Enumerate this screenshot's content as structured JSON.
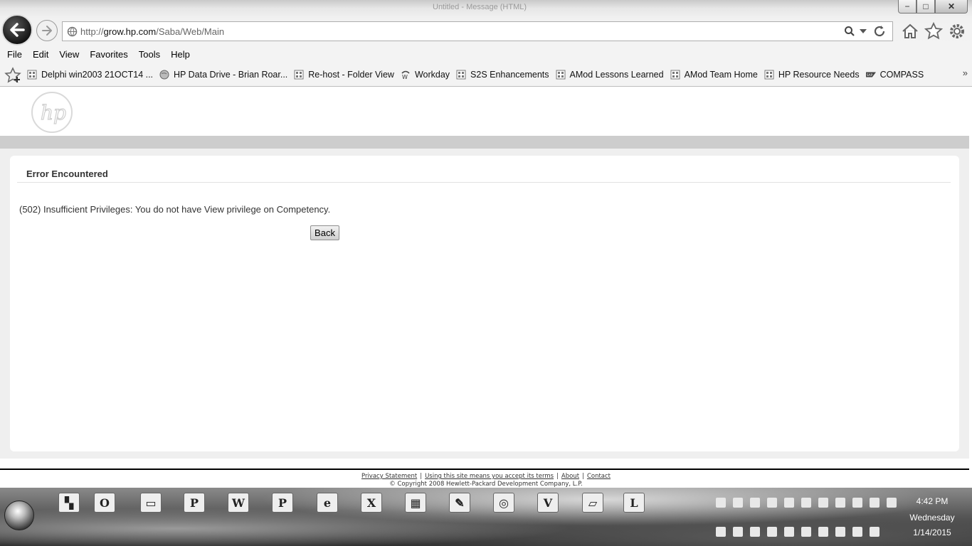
{
  "browser": {
    "window_title": "Untitled - Message (HTML)",
    "address": {
      "prefix": "http://",
      "domain": "grow.hp.com",
      "path": "/Saba/Web/Main"
    },
    "window_controls": {
      "minimize": "−",
      "maximize": "□",
      "close": "✕"
    }
  },
  "menu": [
    "File",
    "Edit",
    "View",
    "Favorites",
    "Tools",
    "Help"
  ],
  "favorites": [
    {
      "label": "Delphi win2003 21OCT14 ...",
      "icon": "sharepoint-icon"
    },
    {
      "label": "HP Data Drive - Brian Roar...",
      "icon": "globe-icon"
    },
    {
      "label": "Re-host - Folder View",
      "icon": "sharepoint-icon"
    },
    {
      "label": "Workday",
      "icon": "workday-icon"
    },
    {
      "label": "S2S Enhancements",
      "icon": "sharepoint-icon"
    },
    {
      "label": "AMod Lessons Learned",
      "icon": "sharepoint-icon"
    },
    {
      "label": "AMod Team Home",
      "icon": "sharepoint-icon"
    },
    {
      "label": "HP Resource Needs",
      "icon": "sharepoint-icon"
    },
    {
      "label": "COMPASS",
      "icon": "sap-icon"
    }
  ],
  "favorites_overflow": "»",
  "page": {
    "error_title": "Error Encountered",
    "error_message": "(502) Insufficient Privileges: You do not have View privilege on Competency.",
    "back_button": "Back",
    "footer": {
      "links": [
        "Privacy Statement",
        "Using this site means you accept its terms",
        "About",
        "Contact"
      ],
      "separator": "|",
      "copyright": "© Copyright 2008 Hewlett-Packard Development Company, L.P."
    }
  },
  "taskbar": {
    "apps": [
      {
        "name": "outlook",
        "glyph": "O",
        "active": true
      },
      {
        "name": "file-explorer",
        "glyph": "▭",
        "active": true
      },
      {
        "name": "powerpoint",
        "glyph": "P",
        "active": false
      },
      {
        "name": "word",
        "glyph": "W",
        "active": false
      },
      {
        "name": "project",
        "glyph": "P",
        "active": false
      },
      {
        "name": "internet-explorer",
        "glyph": "e",
        "active": true
      },
      {
        "name": "excel",
        "glyph": "X",
        "active": false
      },
      {
        "name": "calculator",
        "glyph": "▦",
        "active": false
      },
      {
        "name": "paint",
        "glyph": "✎",
        "active": false
      },
      {
        "name": "chrome",
        "glyph": "◎",
        "active": false
      },
      {
        "name": "visio",
        "glyph": "V",
        "active": false
      },
      {
        "name": "notes",
        "glyph": "▱",
        "active": true
      },
      {
        "name": "lync",
        "glyph": "L",
        "active": true
      }
    ],
    "clock": {
      "time": "4:42 PM",
      "day": "Wednesday",
      "date": "1/14/2015"
    }
  }
}
